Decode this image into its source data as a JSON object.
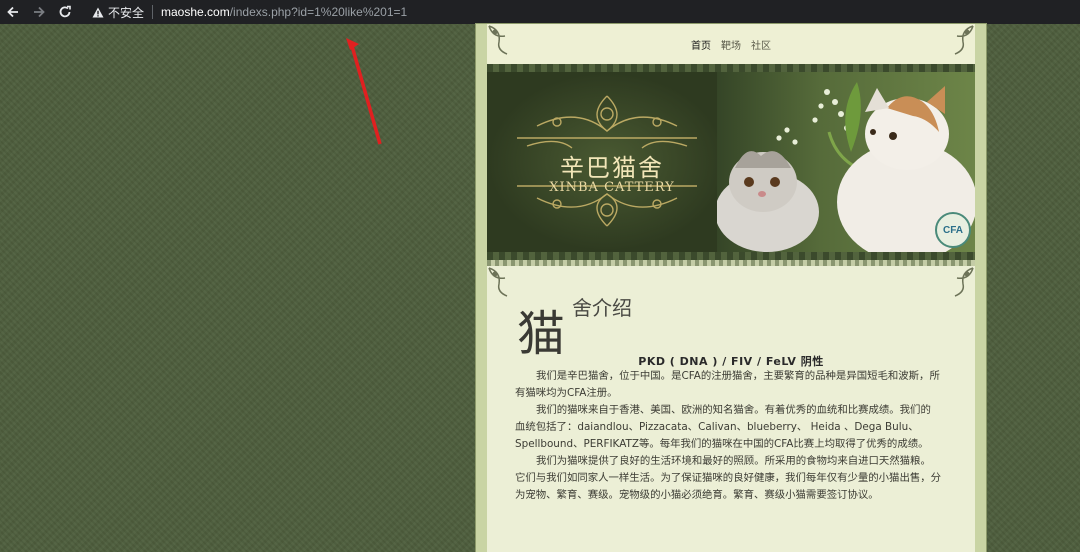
{
  "browser": {
    "insecure_label": "不安全",
    "url_host": "maoshe.com",
    "url_path": "/indexs.php?id=1%20like%201=1"
  },
  "nav": {
    "items": [
      {
        "label": "首页",
        "active": true
      },
      {
        "label": "靶场",
        "active": false
      },
      {
        "label": "社区",
        "active": false
      }
    ]
  },
  "banner": {
    "title_cn": "辛巴猫舍",
    "title_en": "XINBA CATTERY",
    "badge": "CFA"
  },
  "section": {
    "big_char": "猫",
    "title_rest": "舍介绍",
    "heading": "PKD ( DNA ) / FIV / FeLV 阴性",
    "paragraphs": [
      "我们是辛巴猫舍，位于中国。是CFA的注册猫舍，主要繁育的品种是异国短毛和波斯，所有猫咪均为CFA注册。",
      "我们的猫咪来自于香港、美国、欧洲的知名猫舍。有着优秀的血统和比赛成绩。我们的血统包括了：daiandlou、Pizzacata、Calivan、blueberry、 Heida 、Dega Bulu、Spellbound、PERFIKATZ等。每年我们的猫咪在中国的CFA比赛上均取得了优秀的成绩。",
      "我们为猫咪提供了良好的生活环境和最好的照顾。所采用的食物均来自进口天然猫粮。它们与我们如同家人一样生活。为了保证猫咪的良好健康，我们每年仅有少量的小猫出售，分为宠物、繁育、赛级。宠物级的小猫必须绝育。繁育、赛级小猫需要签订协议。"
    ]
  },
  "colors": {
    "page_bg": "#4e5e3d",
    "annotation_arrow": "#e02020"
  }
}
